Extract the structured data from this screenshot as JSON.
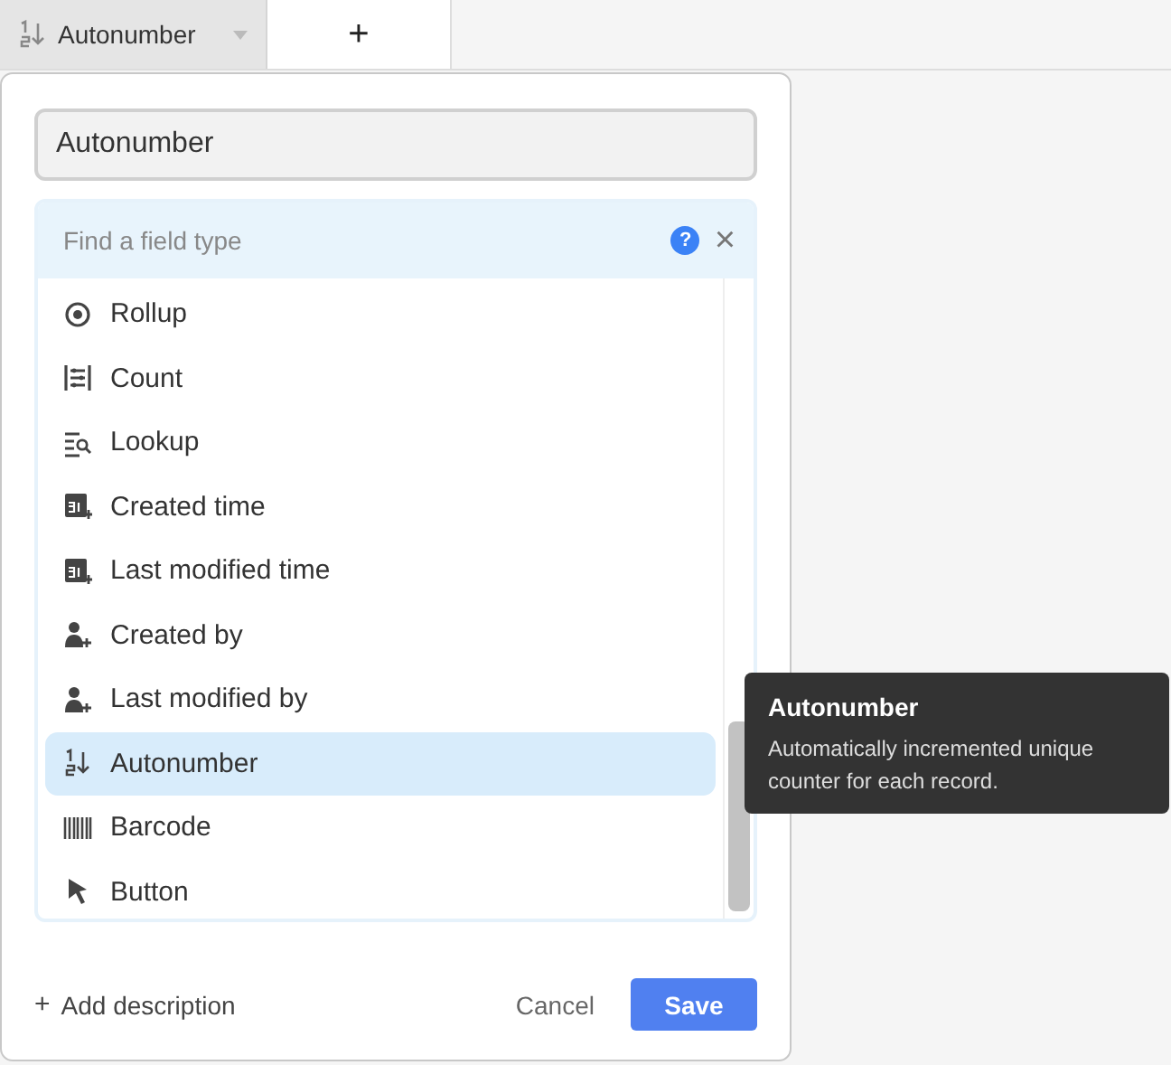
{
  "header": {
    "column": {
      "label": "Autonumber",
      "kind": "autonumber"
    },
    "add_label": "+"
  },
  "field_name": {
    "value": "Autonumber"
  },
  "search": {
    "placeholder": "Find a field type",
    "help": "?",
    "close": "×"
  },
  "field_types": [
    {
      "label": "Rollup",
      "kind": "rollup",
      "selected": false
    },
    {
      "label": "Count",
      "kind": "count",
      "selected": false
    },
    {
      "label": "Lookup",
      "kind": "lookup",
      "selected": false
    },
    {
      "label": "Created time",
      "kind": "calendar",
      "selected": false
    },
    {
      "label": "Last modified time",
      "kind": "calendar",
      "selected": false
    },
    {
      "label": "Created by",
      "kind": "person",
      "selected": false
    },
    {
      "label": "Last modified by",
      "kind": "person",
      "selected": false
    },
    {
      "label": "Autonumber",
      "kind": "autonumber",
      "selected": true
    },
    {
      "label": "Barcode",
      "kind": "barcode",
      "selected": false
    },
    {
      "label": "Button",
      "kind": "cursor",
      "selected": false
    }
  ],
  "footer": {
    "add_description": "Add description",
    "add_icon": "+",
    "cancel": "Cancel",
    "save": "Save"
  },
  "tooltip": {
    "title": "Autonumber",
    "text": "Automatically incremented unique counter for each record."
  }
}
